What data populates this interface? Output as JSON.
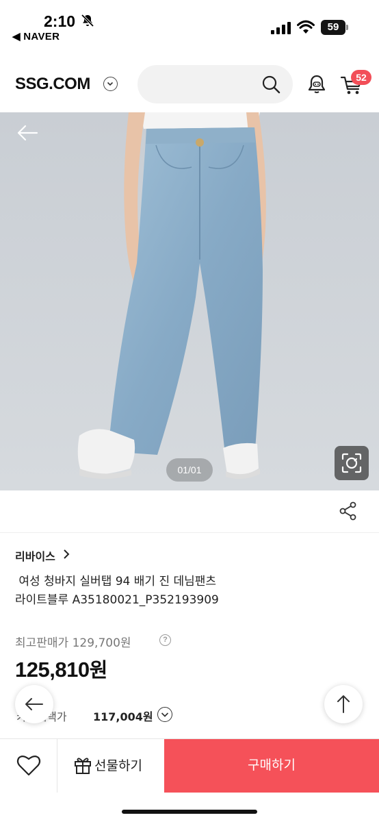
{
  "status_bar": {
    "time": "2:10",
    "back_app": "◀ NAVER",
    "battery": "59"
  },
  "header": {
    "logo": "SSG.COM",
    "cart_count": "52"
  },
  "gallery": {
    "page_indicator": "01/01"
  },
  "product": {
    "brand": "리바이스",
    "title": " 여성 청바지 실버탭 94 배기 진 데님팬츠\n라이트블루 A35180021_P352193909",
    "max_price": "최고판매가 129,700원",
    "sale_price": "125,810",
    "sale_unit": "원",
    "card_label": "카드혜택가",
    "card_price": "117,004원"
  },
  "bottom_bar": {
    "gift_label": "선물하기",
    "buy_label": "구매하기"
  },
  "colors": {
    "accent": "#f55159",
    "badge": "#f24e58"
  }
}
